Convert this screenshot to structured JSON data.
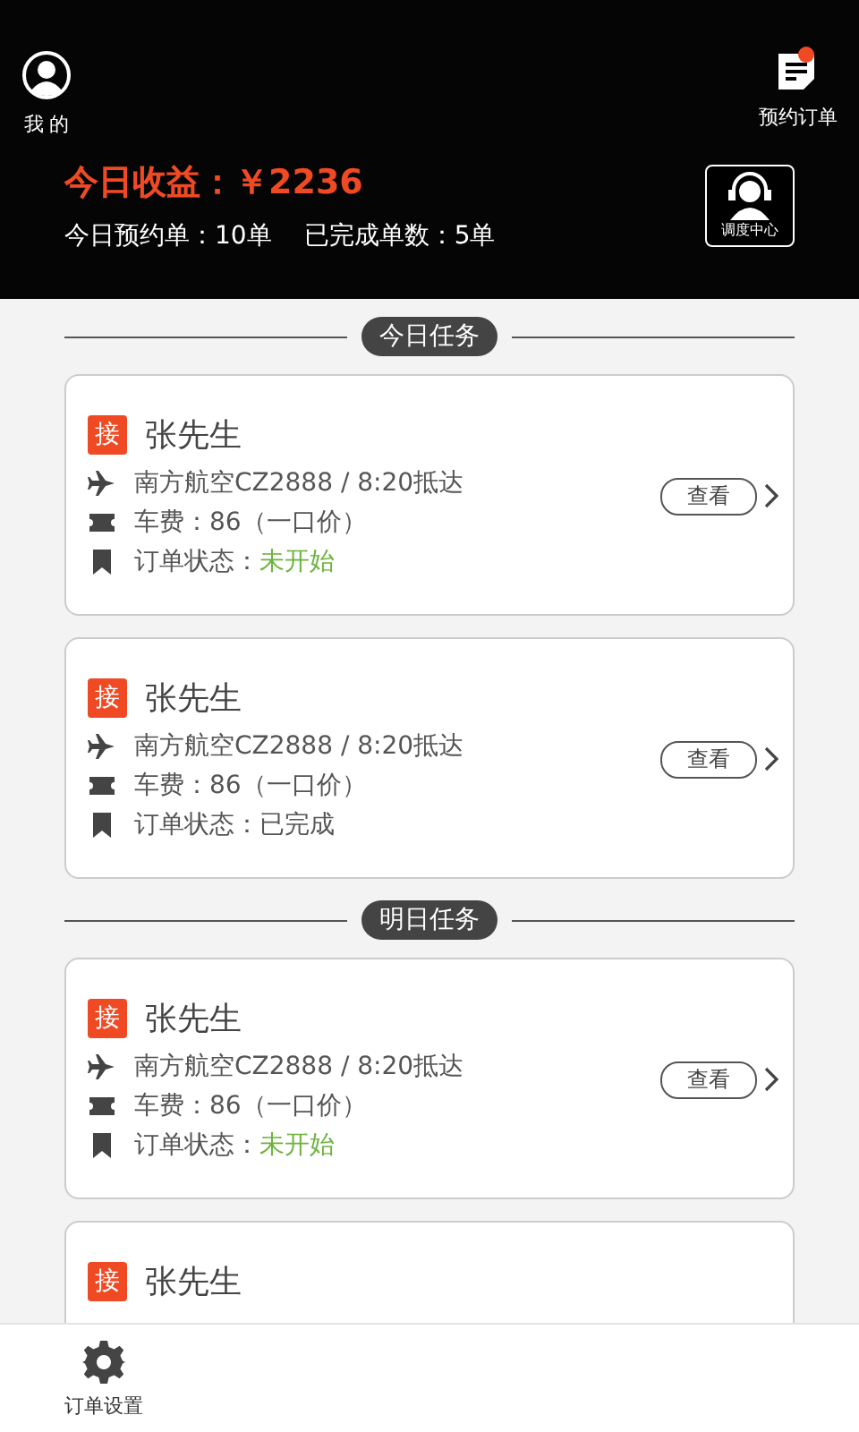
{
  "header": {
    "profile_label": "我 的",
    "orders_label": "预约订单",
    "orders_unread": true,
    "earnings": "今日收益：￥2236",
    "booked": "今日预约单：10单",
    "completed": "已完成单数：5单",
    "dispatch_label": "调度中心"
  },
  "sections": [
    {
      "title": "今日任务",
      "orders": [
        {
          "tag": "接",
          "name": "张先生",
          "flight": "南方航空CZ2888 / 8:20抵达",
          "fare": "车费：86（一口价）",
          "status_label": "订单状态：",
          "status": "未开始",
          "completed": false,
          "view_label": "查看"
        },
        {
          "tag": "接",
          "name": "张先生",
          "flight": "南方航空CZ2888 / 8:20抵达",
          "fare": "车费：86（一口价）",
          "status_label": "订单状态：",
          "status": "已完成",
          "completed": true,
          "view_label": "查看"
        }
      ]
    },
    {
      "title": "明日任务",
      "orders": [
        {
          "tag": "接",
          "name": "张先生",
          "flight": "南方航空CZ2888 / 8:20抵达",
          "fare": "车费：86（一口价）",
          "status_label": "订单状态：",
          "status": "未开始",
          "completed": false,
          "view_label": "查看"
        },
        {
          "tag": "接",
          "name": "张先生"
        }
      ]
    }
  ],
  "footer": {
    "settings_label": "订单设置"
  }
}
